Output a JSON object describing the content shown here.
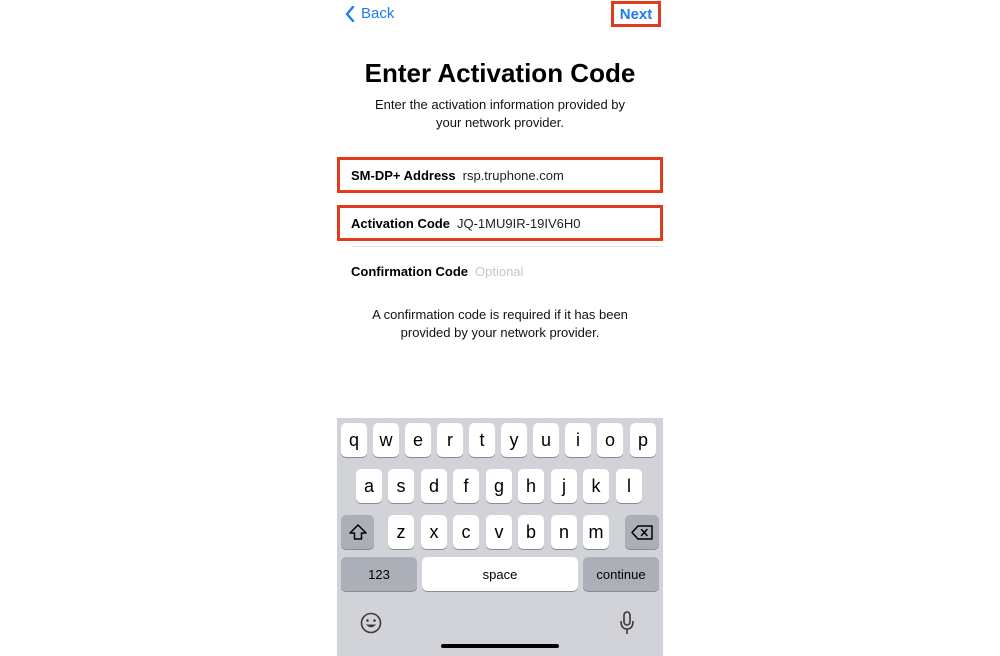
{
  "nav": {
    "back_label": "Back",
    "next_label": "Next"
  },
  "header": {
    "title": "Enter Activation Code",
    "subtitle_line1": "Enter the activation information provided by",
    "subtitle_line2": "your network provider."
  },
  "form": {
    "smdp_label": "SM-DP+ Address",
    "smdp_value": "rsp.truphone.com",
    "activation_label": "Activation Code",
    "activation_value": "JQ-1MU9IR-19IV6H0",
    "confirmation_label": "Confirmation Code",
    "confirmation_placeholder": "Optional"
  },
  "note": {
    "line1": "A confirmation code is required if it has been",
    "line2": "provided by your network provider."
  },
  "keyboard": {
    "row1": [
      "q",
      "w",
      "e",
      "r",
      "t",
      "y",
      "u",
      "i",
      "o",
      "p"
    ],
    "row2": [
      "a",
      "s",
      "d",
      "f",
      "g",
      "h",
      "j",
      "k",
      "l"
    ],
    "row3": [
      "z",
      "x",
      "c",
      "v",
      "b",
      "n",
      "m"
    ],
    "numbers_label": "123",
    "space_label": "space",
    "continue_label": "continue",
    "icons": [
      "shift-icon",
      "delete-icon",
      "emoji-icon",
      "microphone-icon"
    ]
  },
  "colors": {
    "accent": "#1f7bf0",
    "highlight": "#e23a1c",
    "keyboard_bg": "#d2d3d8"
  }
}
